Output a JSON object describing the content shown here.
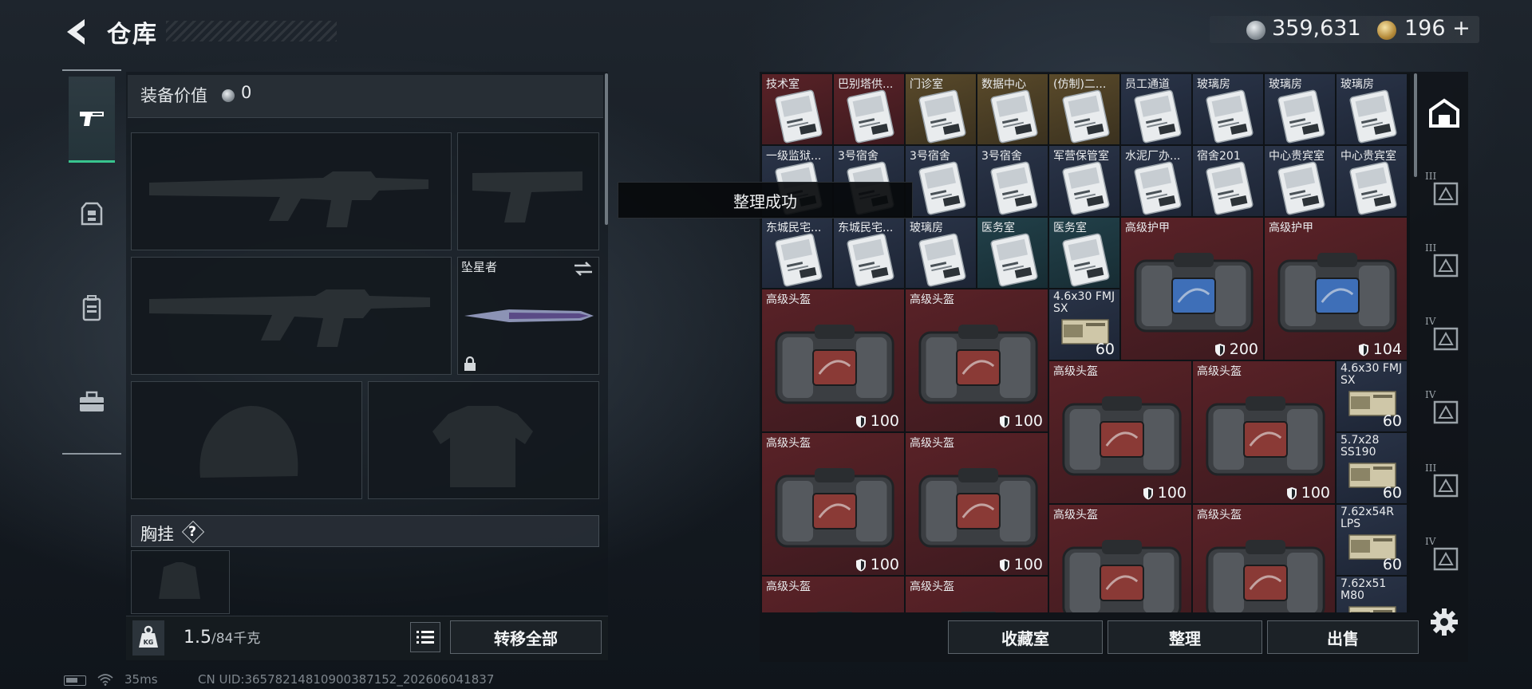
{
  "header": {
    "title": "仓库"
  },
  "currency": {
    "silver": "359,631",
    "gold": "196",
    "gold_add": "+"
  },
  "equipment": {
    "value_label": "装备价值",
    "value": "0",
    "melee_name": "坠星者",
    "chest_label": "胸挂",
    "chest_help": "?"
  },
  "footer_left": {
    "weight_current": "1.5",
    "weight_max": "/84千克",
    "transfer_all": "转移全部"
  },
  "toast": "整理成功",
  "stash": {
    "items": [
      {
        "label": "技术室",
        "kind": "keycard",
        "tone": "red"
      },
      {
        "label": "巴别塔供...",
        "kind": "keycard",
        "tone": "red"
      },
      {
        "label": "门诊室",
        "kind": "keycard",
        "tone": "gold"
      },
      {
        "label": "数据中心",
        "kind": "keycard",
        "tone": "gold"
      },
      {
        "label": "(仿制)二...",
        "kind": "keycard",
        "tone": "gold"
      },
      {
        "label": "员工通道",
        "kind": "keycard",
        "tone": "blue"
      },
      {
        "label": "玻璃房",
        "kind": "keycard",
        "tone": "blue"
      },
      {
        "label": "玻璃房",
        "kind": "keycard",
        "tone": "blue"
      },
      {
        "label": "玻璃房",
        "kind": "keycard",
        "tone": "blue"
      },
      {
        "label": "一级监狱...",
        "kind": "keycard",
        "tone": "blue"
      },
      {
        "label": "3号宿舍",
        "kind": "keycard",
        "tone": "blue"
      },
      {
        "label": "3号宿舍",
        "kind": "keycard",
        "tone": "blue"
      },
      {
        "label": "3号宿舍",
        "kind": "keycard",
        "tone": "blue"
      },
      {
        "label": "军营保管室",
        "kind": "keycard",
        "tone": "blue"
      },
      {
        "label": "水泥厂办...",
        "kind": "keycard",
        "tone": "blue"
      },
      {
        "label": "宿舍201",
        "kind": "keycard",
        "tone": "blue"
      },
      {
        "label": "中心贵宾室",
        "kind": "keycard",
        "tone": "blue"
      },
      {
        "label": "中心贵宾室",
        "kind": "keycard",
        "tone": "blue"
      },
      {
        "label": "东城民宅...",
        "kind": "keycard",
        "tone": "blue"
      },
      {
        "label": "东城民宅...",
        "kind": "keycard",
        "tone": "blue"
      },
      {
        "label": "玻璃房",
        "kind": "keycard",
        "tone": "blue"
      },
      {
        "label": "医务室",
        "kind": "keycard",
        "tone": "teal"
      },
      {
        "label": "医务室",
        "kind": "keycard",
        "tone": "teal"
      },
      {
        "label": "高级护甲",
        "kind": "bag-blue",
        "tone": "red",
        "value": "200"
      },
      {
        "label": "高级护甲",
        "kind": "bag-blue",
        "tone": "red",
        "value": "104"
      },
      {
        "label": "高级头盔",
        "kind": "bag-red",
        "tone": "red",
        "value": "100"
      },
      {
        "label": "高级头盔",
        "kind": "bag-red",
        "tone": "red",
        "value": "100"
      },
      {
        "label": "4.6x30 FMJ SX",
        "kind": "ammo",
        "tone": "blue",
        "value": "60"
      },
      {
        "label": "高级头盔",
        "kind": "bag-red",
        "tone": "red",
        "value": "100"
      },
      {
        "label": "高级头盔",
        "kind": "bag-red",
        "tone": "red",
        "value": "100"
      },
      {
        "label": "4.6x30 FMJ SX",
        "kind": "ammo",
        "tone": "blue",
        "value": "60"
      },
      {
        "label": "高级头盔",
        "kind": "bag-red",
        "tone": "red",
        "value": "100"
      },
      {
        "label": "高级头盔",
        "kind": "bag-red",
        "tone": "red",
        "value": "100"
      },
      {
        "label": "5.7x28 SS190",
        "kind": "ammo",
        "tone": "blue",
        "value": "60"
      },
      {
        "label": "高级头盔",
        "kind": "bag-red",
        "tone": "red",
        "value": ""
      },
      {
        "label": "高级头盔",
        "kind": "bag-red",
        "tone": "red",
        "value": ""
      },
      {
        "label": "7.62x54R LPS",
        "kind": "ammo",
        "tone": "blue",
        "value": "60"
      },
      {
        "label": "高级头盔",
        "kind": "bag-red",
        "tone": "red",
        "value": ""
      },
      {
        "label": "高级头盔",
        "kind": "bag-red",
        "tone": "red",
        "value": ""
      },
      {
        "label": "7.62x51 M80",
        "kind": "ammo",
        "tone": "blue",
        "value": ""
      }
    ]
  },
  "footer_right": {
    "collection": "收藏室",
    "organize": "整理",
    "sell": "出售"
  },
  "right_tabs": [
    {
      "icon": "stash-home-icon",
      "roman": ""
    },
    {
      "icon": "container-icon",
      "roman": "III"
    },
    {
      "icon": "container-icon",
      "roman": "III"
    },
    {
      "icon": "container-icon",
      "roman": "IV"
    },
    {
      "icon": "container-icon",
      "roman": "IV"
    },
    {
      "icon": "container-icon",
      "roman": "III"
    },
    {
      "icon": "container-icon",
      "roman": "IV"
    }
  ],
  "status": {
    "ping": "35ms",
    "uid": "CN UID:3657821481090038715​2_202606041837"
  },
  "colors": {
    "accent": "#38c48e",
    "rare_red": "#5a2227",
    "gold": "#5a4a2a",
    "blue": "#2a3448"
  }
}
